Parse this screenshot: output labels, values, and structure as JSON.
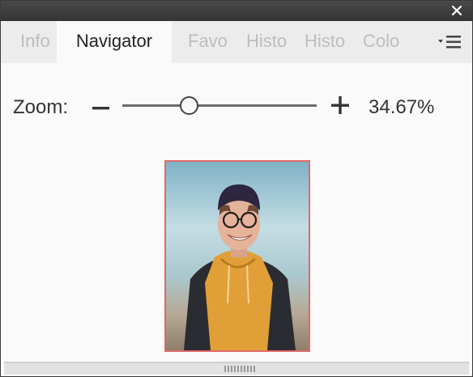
{
  "tabs": [
    {
      "label": "Info",
      "active": false
    },
    {
      "label": "Navigator",
      "active": true
    },
    {
      "label": "Favo",
      "active": false
    },
    {
      "label": "Histo",
      "active": false
    },
    {
      "label": "Histo",
      "active": false
    },
    {
      "label": "Colo",
      "active": false
    }
  ],
  "zoom": {
    "label": "Zoom:",
    "value_text": "34.67%",
    "slider_position": 0.34
  },
  "icons": {
    "close": "close-icon",
    "panel_menu": "panel-menu-icon",
    "zoom_out": "minus-icon",
    "zoom_in": "plus-icon"
  },
  "colors": {
    "view_rect": "#e06969",
    "titlebar": "#3a3a3a"
  }
}
